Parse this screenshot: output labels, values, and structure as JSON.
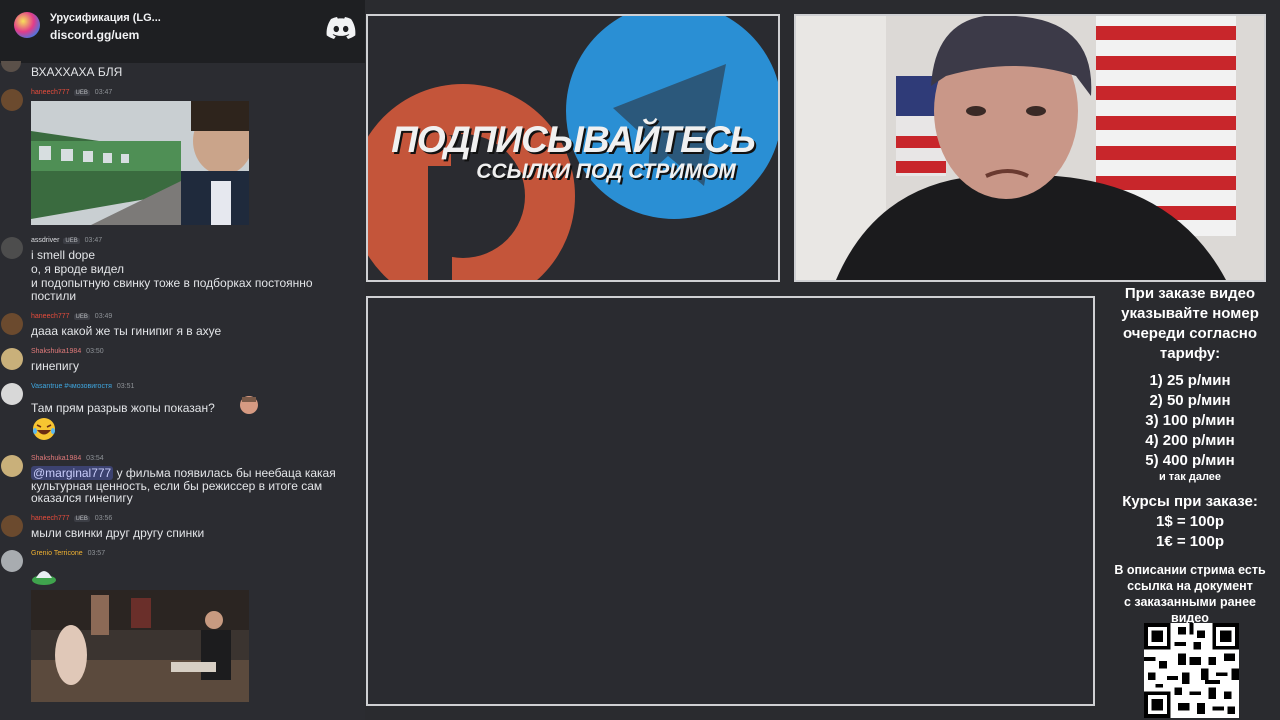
{
  "widget": {
    "server_name": "Урусификация (LG...",
    "invite": "discord.gg/uem"
  },
  "messages": [
    {
      "text": "ВХАХХАХА БЛЯ"
    },
    {
      "author": "haneech777",
      "badges": [
        "UEB"
      ],
      "time": "03:47",
      "color": "#e74c3c"
    },
    {
      "author": "assdriver",
      "badges": [
        "UEB"
      ],
      "time": "03:47",
      "color": "#dcdde1",
      "lines": [
        "i smell dope",
        "о, я вроде видел",
        "и подопытную свинку тоже в подборках постоянно",
        "постили"
      ]
    },
    {
      "author": "haneech777",
      "badges": [
        "UEB"
      ],
      "time": "03:49",
      "color": "#e74c3c",
      "lines": [
        "дааа какой же ты гинипиг я в ахуе"
      ]
    },
    {
      "author": "Shakshuka1984",
      "time": "03:50",
      "color": "#e07a7a",
      "lines": [
        "гинепигу"
      ]
    },
    {
      "author": "Vasantrue #чмозовигостя",
      "time": "03:51",
      "color": "#3fa7e0",
      "lines": [
        "Там прям разрыв жопы показан?"
      ]
    },
    {
      "author": "Shakshuka1984",
      "time": "03:54",
      "color": "#e07a7a",
      "mention": "@marginal777",
      "lines": [
        " у фильма появилась бы неебаца какая",
        "культурная ценность, если бы режиссер в итоге сам",
        "оказался гинепигу"
      ]
    },
    {
      "author": "haneech777",
      "badges": [
        "UEB"
      ],
      "time": "03:56",
      "color": "#e74c3c",
      "lines": [
        "мыли свинки друг другу спинки"
      ]
    },
    {
      "author": "Grenio Terricone",
      "time": "03:57",
      "color": "#f0b232"
    }
  ],
  "promo": {
    "title": "ПОДПИСЫВАЙТЕСЬ",
    "subtitle": "ССЫЛКИ ПОД СТРИМОМ"
  },
  "info": {
    "order_text": [
      "При заказе видео",
      "указывайте номер",
      "очереди согласно",
      "тарифу:"
    ],
    "tariffs": [
      "1) 25 р/мин",
      "2) 50 р/мин",
      "3) 100 р/мин",
      "4) 200 р/мин",
      "5) 400 р/мин"
    ],
    "and_so_on": "и так далее",
    "rates_title": "Курсы при заказе:",
    "rates": [
      "1$ = 100р",
      "1€ = 100р"
    ],
    "doc_text": [
      "В описании стрима есть",
      "ссылка на документ",
      "с заказанными ранее",
      "видео"
    ]
  }
}
